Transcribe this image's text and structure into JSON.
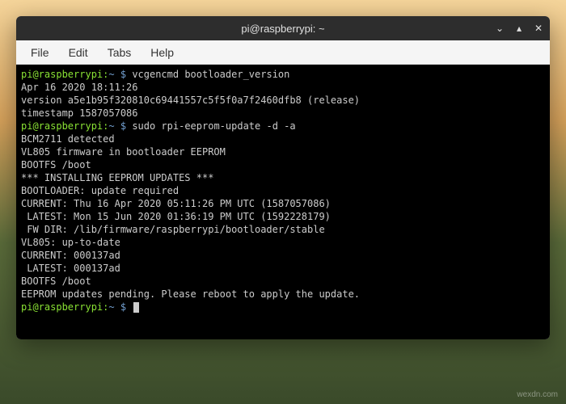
{
  "window": {
    "title": "pi@raspberrypi: ~"
  },
  "menubar": {
    "file": "File",
    "edit": "Edit",
    "tabs": "Tabs",
    "help": "Help"
  },
  "prompt": {
    "user_host": "pi@raspberrypi",
    "colon": ":",
    "path": "~",
    "dollar": " $ "
  },
  "terminal": {
    "cmd1": "vcgencmd bootloader_version",
    "out1_l1": "Apr 16 2020 18:11:26",
    "out1_l2": "version a5e1b95f320810c69441557c5f5f0a7f2460dfb8 (release)",
    "out1_l3": "timestamp 1587057086",
    "cmd2": "sudo rpi-eeprom-update -d -a",
    "out2_l1": "BCM2711 detected",
    "out2_l2": "VL805 firmware in bootloader EEPROM",
    "out2_l3": "BOOTFS /boot",
    "out2_l4": "*** INSTALLING EEPROM UPDATES ***",
    "out2_l5": "BOOTLOADER: update required",
    "out2_l6": "CURRENT: Thu 16 Apr 2020 05:11:26 PM UTC (1587057086)",
    "out2_l7": " LATEST: Mon 15 Jun 2020 01:36:19 PM UTC (1592228179)",
    "out2_l8": " FW DIR: /lib/firmware/raspberrypi/bootloader/stable",
    "out2_l9": "VL805: up-to-date",
    "out2_l10": "CURRENT: 000137ad",
    "out2_l11": " LATEST: 000137ad",
    "out2_l12": "BOOTFS /boot",
    "out2_l13": "EEPROM updates pending. Please reboot to apply the update."
  },
  "watermark": "wexdn.com"
}
